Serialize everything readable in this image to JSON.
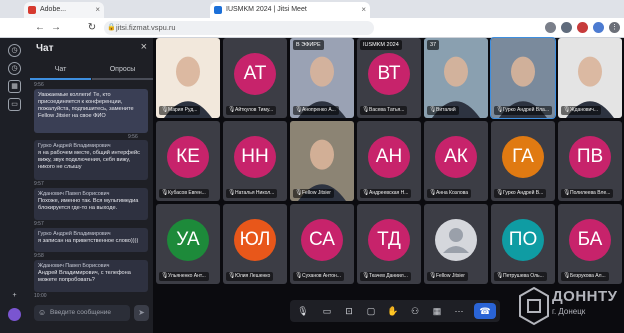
{
  "browser": {
    "tabs": [
      {
        "label": "Adobe...",
        "fav_color": "#d63a2f"
      },
      {
        "label": "IUSMKM 2024 | Jitsi Meet",
        "fav_color": "#1b6fd8"
      }
    ],
    "url": "jitsi.fizmat.vspu.ru",
    "page_title": "IUSMKM 2024 | Jitsi Meet"
  },
  "chat": {
    "title": "Чат",
    "tab_chat": "Чат",
    "tab_polls": "Опросы",
    "accent": "#3e8fe0",
    "messages": [
      {
        "ts": "9:56",
        "sender": "",
        "text": "Уважаемые коллеги! Те, кто присоединяется к конференции, пожалуйста, подпишитесь, замените Fellow Jitsier на свое ФИО",
        "own": true
      },
      {
        "ts": "9:56",
        "sender": "Гурко Андрей Владимирович",
        "text": "я на рабочем месте, общий интерфейс вижу, звук подключения, себя вижу, никого не слышу",
        "own": false
      },
      {
        "ts": "9:57",
        "sender": "Жданович Павел Борисович",
        "text": "Похоже, именно так. Вся мультимедиа блокируется где-то на выходе.",
        "own": false
      },
      {
        "ts": "9:57",
        "sender": "Гурко Андрей Владимирович",
        "text": "я записан на приветственное слово))))",
        "own": false
      },
      {
        "ts": "9:58",
        "sender": "Жданович Павел Борисович",
        "text": "Андрей Владимирович, с телефона можете попробовать?",
        "own": false
      }
    ],
    "last_ts": "10:00",
    "input_placeholder": "Введите сообщение"
  },
  "tiles": [
    {
      "name": "Мария Руд...",
      "type": "video",
      "bg": "#f2e8dc",
      "initials": ""
    },
    {
      "name": "Айткулов Тиму...",
      "type": "avatar",
      "color": "#c7236b",
      "initials": "АТ"
    },
    {
      "name": "Анопренко А...",
      "type": "video",
      "bg": "#9aa2b4",
      "initials": "",
      "badge": "В ЭФИРЕ"
    },
    {
      "name": "Васева Татья...",
      "type": "avatar",
      "color": "#c7236b",
      "initials": "ВТ",
      "badge": "IUSMKM 2024"
    },
    {
      "name": "Виталий",
      "type": "video",
      "bg": "#8aa0b0",
      "initials": "",
      "badge": "37"
    },
    {
      "name": "Гурко Андрей Вла...",
      "type": "video",
      "bg": "#7a8a9c",
      "initials": "",
      "active": true
    },
    {
      "name": "Жданович...",
      "type": "video",
      "bg": "#e4e4e4",
      "initials": ""
    },
    {
      "name": "Кубасов Евген...",
      "type": "avatar",
      "color": "#c7236b",
      "initials": "КЕ"
    },
    {
      "name": "Наталья Никол...",
      "type": "avatar",
      "color": "#c7236b",
      "initials": "НН"
    },
    {
      "name": "Fellow Jitsier",
      "type": "video",
      "bg": "#8c8474",
      "initials": ""
    },
    {
      "name": "Андреевская Н...",
      "type": "avatar",
      "color": "#c7236b",
      "initials": "АН"
    },
    {
      "name": "Анна Козлова",
      "type": "avatar",
      "color": "#c7236b",
      "initials": "АК"
    },
    {
      "name": "Гурко Андрей В...",
      "type": "avatar",
      "color": "#e07a12",
      "initials": "ГА"
    },
    {
      "name": "Полилеева Вле...",
      "type": "avatar",
      "color": "#c7236b",
      "initials": "ПВ"
    },
    {
      "name": "Ульяненко Ант...",
      "type": "avatar",
      "color": "#1d8a3a",
      "initials": "УА"
    },
    {
      "name": "Юлия Лешенко",
      "type": "avatar",
      "color": "#e8571a",
      "initials": "ЮЛ"
    },
    {
      "name": "Суханов Антон...",
      "type": "avatar",
      "color": "#c7236b",
      "initials": "СА"
    },
    {
      "name": "Ткачев Даниил...",
      "type": "avatar",
      "color": "#c7236b",
      "initials": "ТД"
    },
    {
      "name": "Fellow Jitsier",
      "type": "placeholder",
      "color": "#9aa0aa",
      "initials": ""
    },
    {
      "name": "Петрушева Оль...",
      "type": "avatar",
      "color": "#0f9ca3",
      "initials": "ПО"
    },
    {
      "name": "Безрукова Ал...",
      "type": "avatar",
      "color": "#c7236b",
      "initials": "БА"
    }
  ],
  "watermark": {
    "title": "ДОННТУ",
    "subtitle": "г. Донецк"
  }
}
